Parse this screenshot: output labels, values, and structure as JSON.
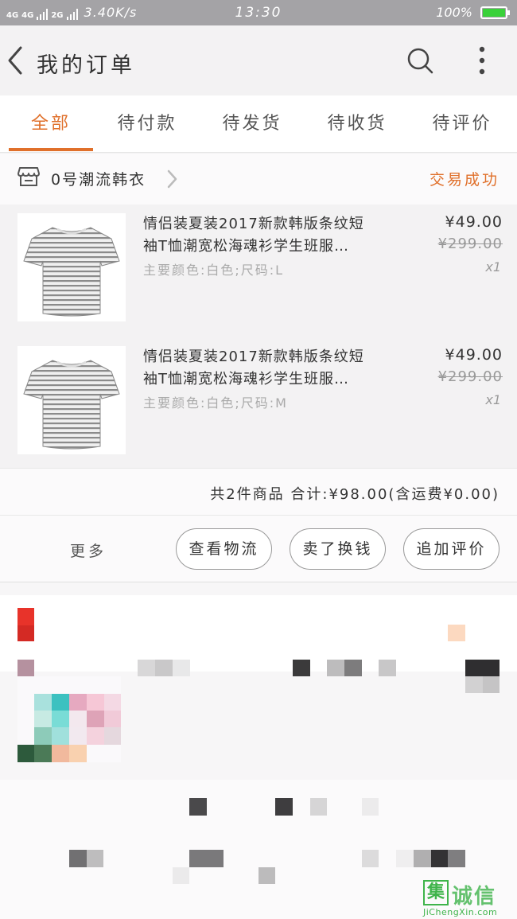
{
  "status_bar": {
    "net1": "4G",
    "net2": "4G",
    "net3": "2G",
    "speed": "3.40K/s",
    "time": "13:30",
    "battery": "100%",
    "battery_level": 1.0
  },
  "header": {
    "title": "我的订单"
  },
  "tabs": [
    "全部",
    "待付款",
    "待发货",
    "待收货",
    "待评价"
  ],
  "active_tab": 0,
  "order": {
    "shop_name": "0号潮流韩衣",
    "status": "交易成功",
    "items": [
      {
        "title_line1": "情侣装夏装2017新款韩版条纹短",
        "title_line2": "袖T恤潮宽松海魂衫学生班服…",
        "spec": "主要颜色:白色;尺码:L",
        "price": "¥49.00",
        "original_price": "¥299.00",
        "qty": "x1"
      },
      {
        "title_line1": "情侣装夏装2017新款韩版条纹短",
        "title_line2": "袖T恤潮宽松海魂衫学生班服…",
        "spec": "主要颜色:白色;尺码:M",
        "price": "¥49.00",
        "original_price": "¥299.00",
        "qty": "x1"
      }
    ],
    "summary": "共2件商品 合计:¥98.00(含运费¥0.00)"
  },
  "actions": {
    "more": "更多",
    "logistics": "查看物流",
    "resell": "卖了换钱",
    "review": "追加评价"
  },
  "colors": {
    "accent": "#e0702b",
    "status_bar": "#a4a3a6"
  },
  "watermark": {
    "word": "诚信",
    "site": "JiChengXin.com"
  }
}
